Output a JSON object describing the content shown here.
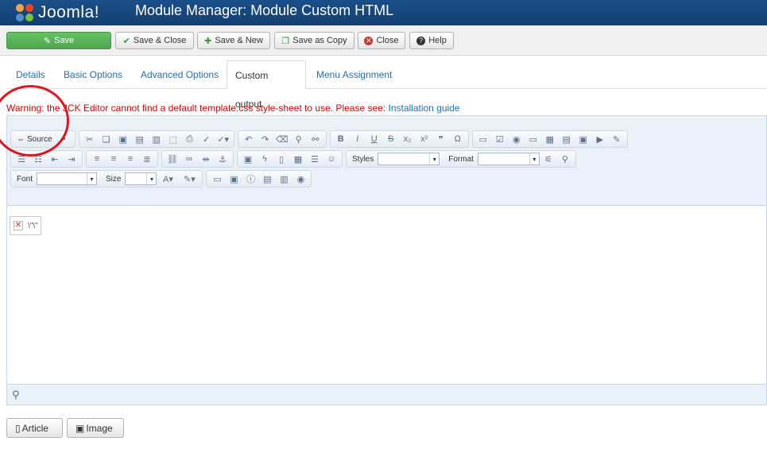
{
  "header": {
    "logo_text": "Joomla!",
    "title": "Module Manager: Module Custom HTML"
  },
  "toolbar": {
    "save": "Save",
    "save_close": "Save & Close",
    "save_new": "Save & New",
    "save_copy": "Save as Copy",
    "close": "Close",
    "help": "Help"
  },
  "tabs": [
    {
      "label": "Details"
    },
    {
      "label": "Basic Options"
    },
    {
      "label": "Advanced Options"
    },
    {
      "label": "Custom output",
      "active": true
    },
    {
      "label": "Menu Assignment"
    }
  ],
  "warning": {
    "text": "Warning: the JCK Editor cannot find a default template.css style-sheet to use. Please see:",
    "link": "Installation guide"
  },
  "editor": {
    "source_label": "Source",
    "styles_label": "Styles",
    "format_label": "Format",
    "font_label": "Font",
    "size_label": "Size",
    "content_text": "\\\"\\\"",
    "bold": "B",
    "italic": "I",
    "underline": "U",
    "strike": "S",
    "subscript": "x₂",
    "superscript": "x²",
    "quote": "❞",
    "omega": "Ω"
  },
  "bottom_buttons": {
    "article": "Article",
    "image": "Image"
  },
  "colors": {
    "header_bg": "#1a4f8a",
    "save_green": "#51a351",
    "link_blue": "#1f6fb4",
    "warning_red": "#e00000",
    "highlight_red": "#e0161e"
  }
}
